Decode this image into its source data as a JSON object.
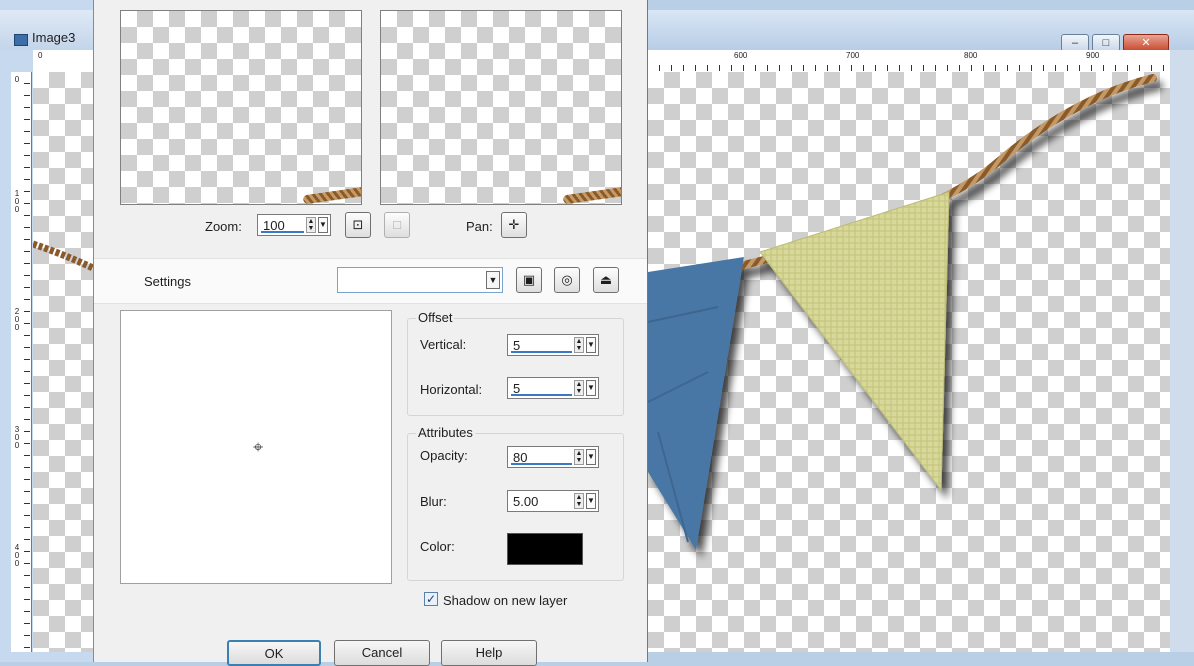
{
  "left_window": {
    "title": "Image3",
    "ruler_top": "0",
    "ruler_side": [
      "0",
      "1\n0\n0",
      "2\n0\n0",
      "3\n0\n0",
      "4\n0\n0"
    ]
  },
  "dialog": {
    "zoom": {
      "label": "Zoom:",
      "value": "100"
    },
    "pan_label": "Pan:",
    "settings": {
      "label": "Settings",
      "value": ""
    },
    "offset": {
      "legend": "Offset",
      "vertical": {
        "label": "Vertical:",
        "value": "5"
      },
      "horizontal": {
        "label": "Horizontal:",
        "value": "5"
      }
    },
    "attributes": {
      "legend": "Attributes",
      "opacity": {
        "label": "Opacity:",
        "value": "80"
      },
      "blur": {
        "label": "Blur:",
        "value": "5.00"
      },
      "color": {
        "label": "Color:",
        "value": "#000000"
      }
    },
    "shadow_on_new_layer": {
      "label": "Shadow on new layer",
      "checked": true
    },
    "buttons": {
      "ok": "OK",
      "cancel": "Cancel",
      "help": "Help"
    }
  },
  "right_window": {
    "ruler_numbers": [
      "600",
      "700",
      "800",
      "900"
    ],
    "controls": {
      "minimize": "–",
      "maximize": "□",
      "close": "✕"
    }
  },
  "colors": {
    "flag_blue": "#4a77a5",
    "flag_yellow": "#d8d89a",
    "rope": "#8a5a2c",
    "shadow_color": "#000000"
  },
  "icons": {
    "zoom_fit": "fit-to-window-icon",
    "zoom_actual": "actual-size-icon",
    "pan": "pan-icon",
    "save_preset": "save-preset-icon",
    "reset": "reset-icon",
    "delete_preset": "delete-preset-icon"
  }
}
